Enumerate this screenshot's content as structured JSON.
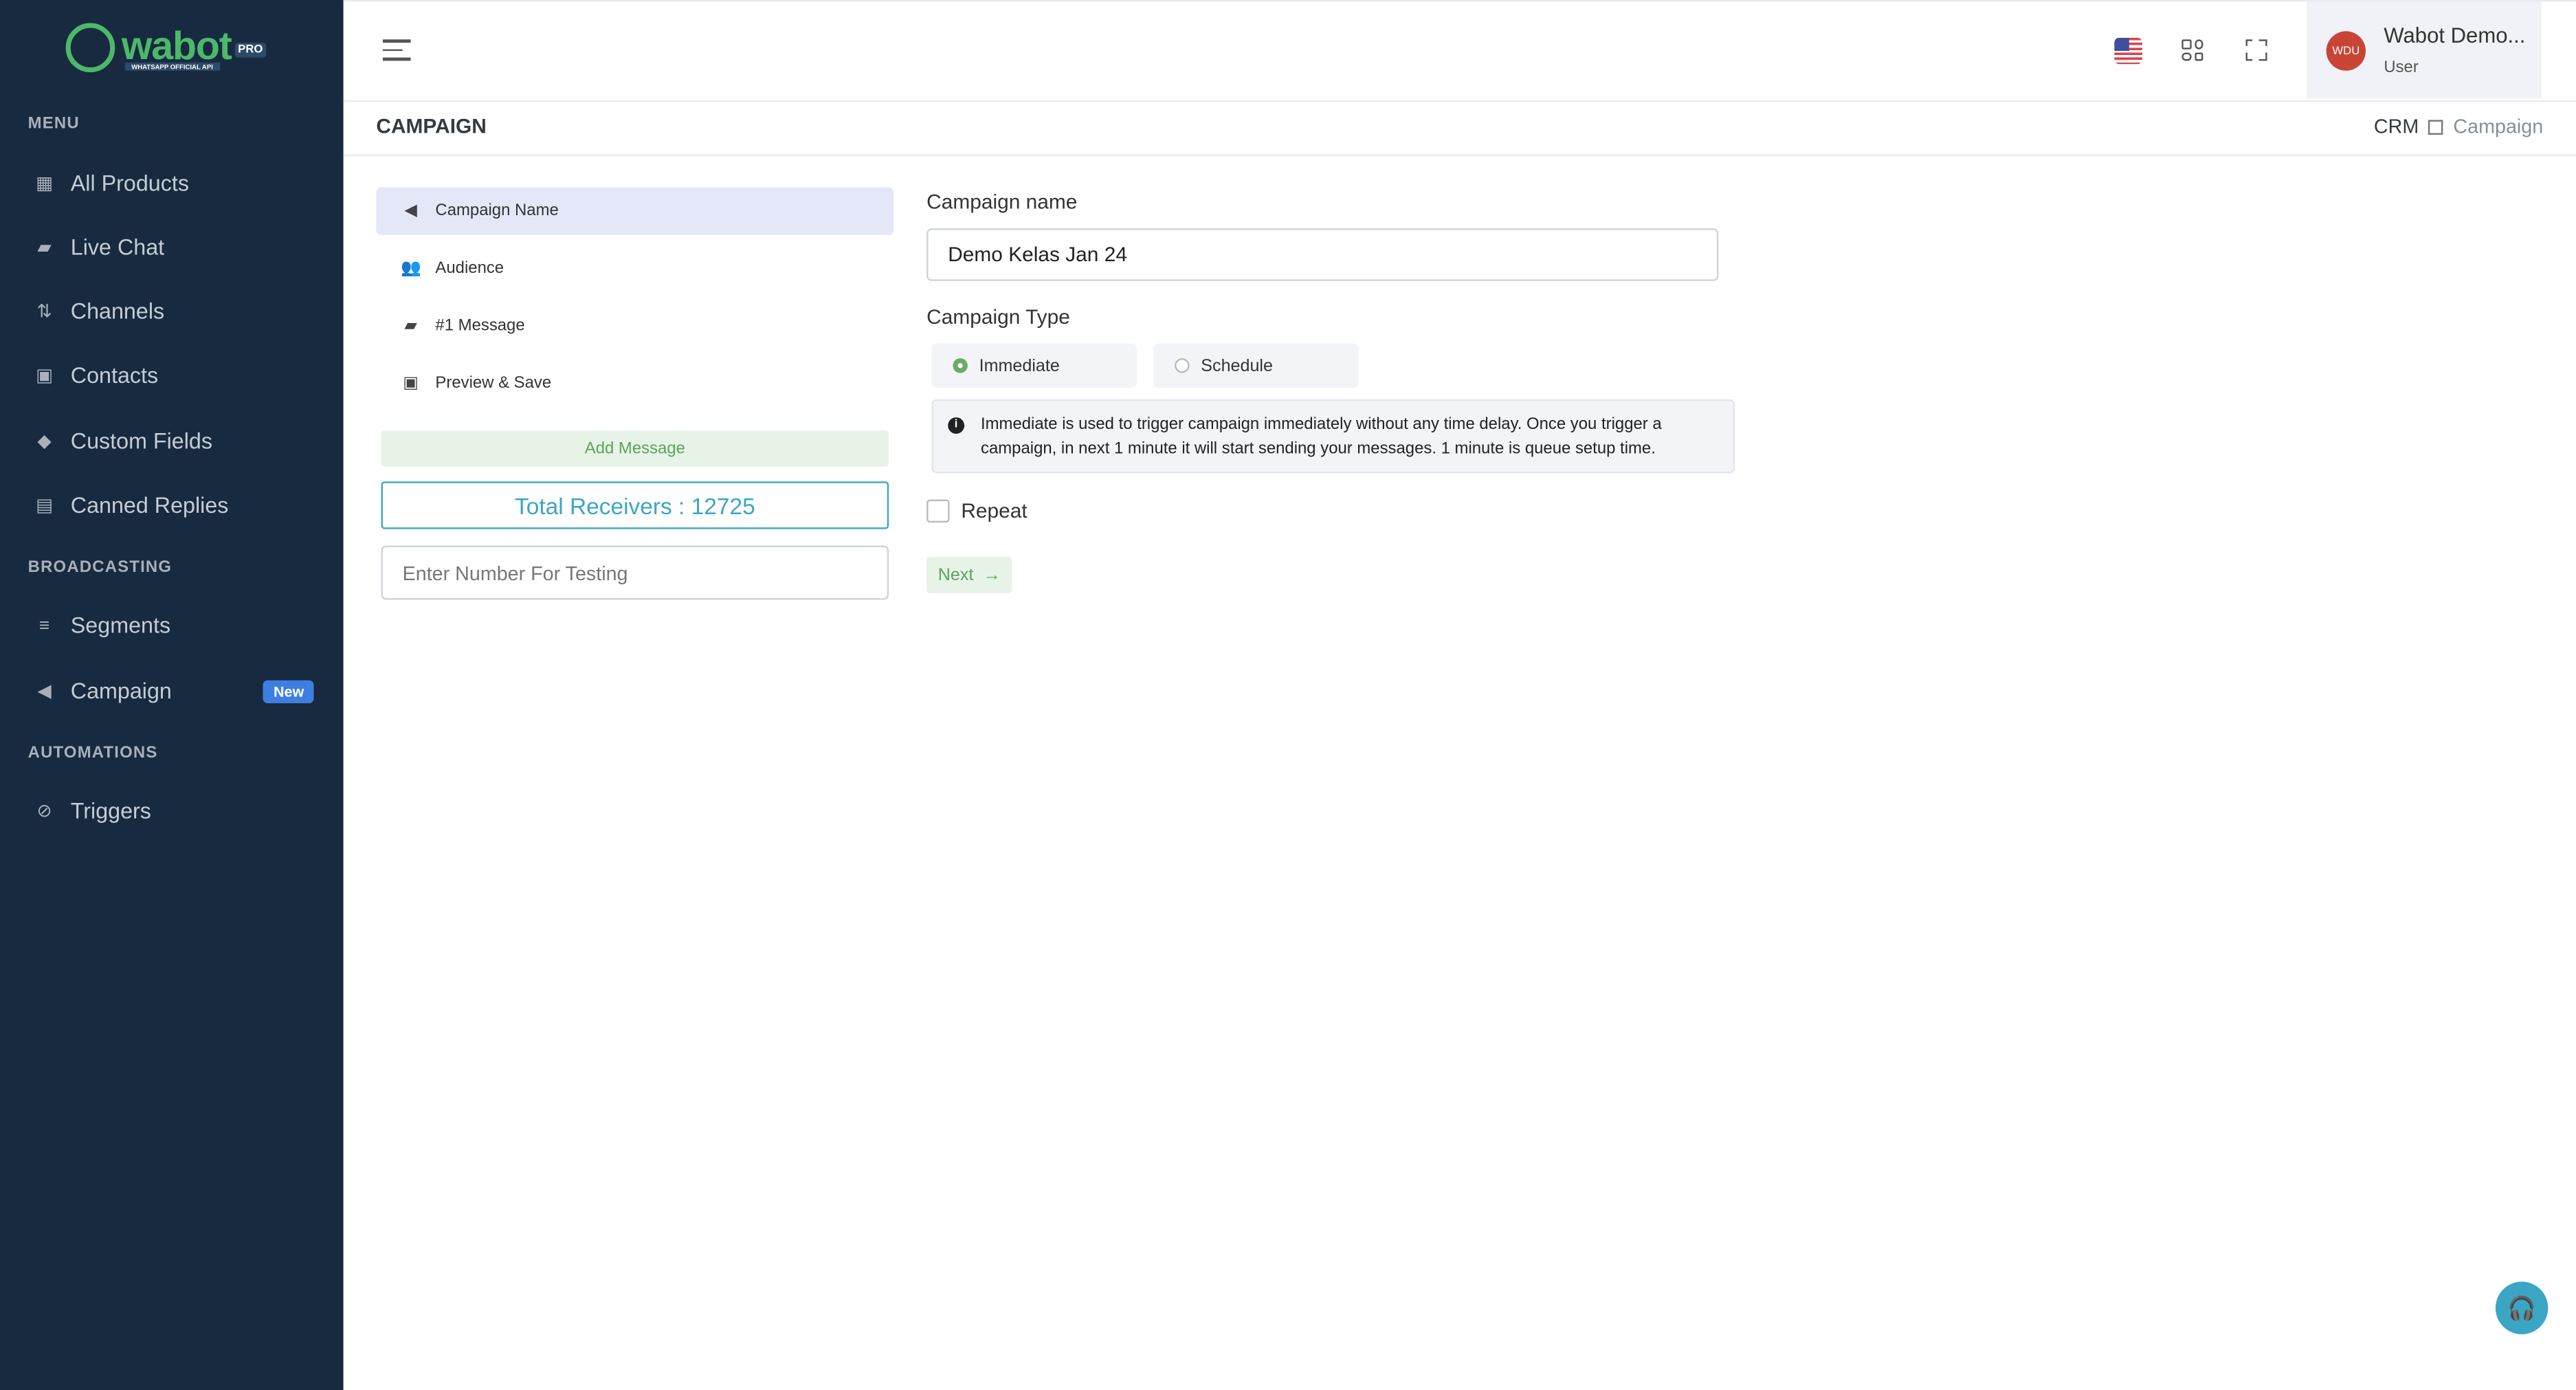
{
  "brand": {
    "name": "wabot",
    "badge": "PRO",
    "tagline": "WHATSAPP OFFICIAL API"
  },
  "sidebar": {
    "sections": [
      {
        "label": "MENU"
      },
      {
        "label": "BROADCASTING"
      },
      {
        "label": "AUTOMATIONS"
      }
    ],
    "items": [
      {
        "label": "All Products",
        "icon": "grid-icon"
      },
      {
        "label": "Live Chat",
        "icon": "chat-icon"
      },
      {
        "label": "Channels",
        "icon": "channels-icon"
      },
      {
        "label": "Contacts",
        "icon": "contact-card-icon"
      },
      {
        "label": "Custom Fields",
        "icon": "tag-icon"
      },
      {
        "label": "Canned Replies",
        "icon": "message-icon"
      },
      {
        "label": "Segments",
        "icon": "filter-icon"
      },
      {
        "label": "Campaign",
        "icon": "megaphone-icon",
        "badge": "New"
      },
      {
        "label": "Triggers",
        "icon": "link-icon"
      }
    ]
  },
  "header": {
    "user_name": "Wabot Demo...",
    "user_role": "User",
    "avatar_initials": "WDU",
    "language": "en-US"
  },
  "page": {
    "title": "CAMPAIGN",
    "breadcrumb": [
      "CRM",
      "Campaign"
    ]
  },
  "steps": [
    {
      "label": "Campaign Name",
      "icon": "megaphone-icon",
      "active": true
    },
    {
      "label": "Audience",
      "icon": "users-icon"
    },
    {
      "label": "#1 Message",
      "icon": "chat-icon"
    },
    {
      "label": "Preview & Save",
      "icon": "save-icon"
    }
  ],
  "add_message": "Add Message",
  "total_receivers": "Total Receivers : 12725",
  "test_number": {
    "placeholder": "Enter Number For Testing",
    "value": ""
  },
  "form": {
    "name_label": "Campaign name",
    "name_value": "Demo Kelas Jan 24",
    "type_label": "Campaign Type",
    "types": [
      {
        "label": "Immediate",
        "selected": true
      },
      {
        "label": "Schedule",
        "selected": false
      }
    ],
    "info": "Immediate is used to trigger campaign immediately without any time delay. Once you trigger a campaign, in next 1 minute it will start sending your messages. 1 minute is queue setup time.",
    "repeat_label": "Repeat",
    "repeat_checked": false,
    "next_label": "Next"
  },
  "colors": {
    "sidebar": "#172a3f",
    "brand_green": "#4cb86a",
    "accent_teal": "#3aa6c4",
    "badge_blue": "#3e7ee0"
  }
}
